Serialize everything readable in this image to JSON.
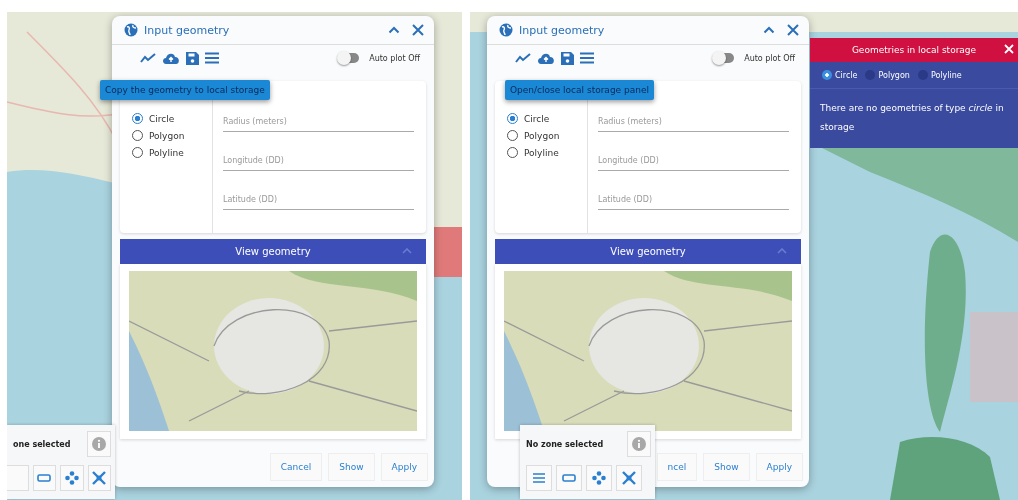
{
  "panes": [
    {
      "dialog": {
        "title": "Input geometry",
        "auto_plot": {
          "label": "Auto plot Off",
          "on": false
        },
        "shapes": [
          {
            "label": "Circle",
            "selected": true
          },
          {
            "label": "Polygon",
            "selected": false
          },
          {
            "label": "Polyline",
            "selected": false
          }
        ],
        "fields": [
          {
            "placeholder": "Radius (meters)"
          },
          {
            "placeholder": "Longitude (DD)"
          },
          {
            "placeholder": "Latitude (DD)"
          }
        ],
        "view_header": "View geometry",
        "buttons": [
          "Cancel",
          "Show",
          "Apply"
        ]
      },
      "tooltip": "Copy the geometry to local storage",
      "zone_panel": {
        "text": "one selected",
        "clipped": true
      }
    },
    {
      "dialog": {
        "title": "Input geometry",
        "auto_plot": {
          "label": "Auto plot Off",
          "on": false
        },
        "shapes": [
          {
            "label": "Circle",
            "selected": true
          },
          {
            "label": "Polygon",
            "selected": false
          },
          {
            "label": "Polyline",
            "selected": false
          }
        ],
        "fields": [
          {
            "placeholder": "Radius (meters)"
          },
          {
            "placeholder": "Longitude (DD)"
          },
          {
            "placeholder": "Latitude (DD)"
          }
        ],
        "view_header": "View geometry",
        "buttons": [
          "ncel",
          "Show",
          "Apply"
        ]
      },
      "tooltip": "Open/close local storage panel",
      "zone_panel": {
        "text": "No zone selected",
        "clipped": false
      },
      "storage_panel": {
        "title": "Geometries in local storage",
        "shapes": [
          {
            "label": "Circle",
            "selected": true
          },
          {
            "label": "Polygon",
            "selected": false
          },
          {
            "label": "Polyline",
            "selected": false
          }
        ],
        "message": "There are no geometries of type *circle* in storage"
      }
    }
  ]
}
